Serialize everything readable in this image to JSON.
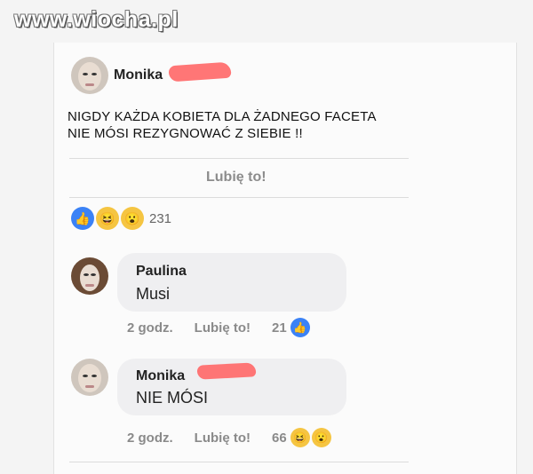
{
  "watermark": "www.wiocha.pl",
  "post": {
    "author": "Monika",
    "line1": "NIGDY KAŻDA KOBIETA DLA ŻADNEGO FACETA",
    "line2": "NIE MÓSI  REZYGNOWAĆ Z SIEBIE !!",
    "like_label": "Lubię to!",
    "reaction_count": "231",
    "reactions": [
      "like-icon",
      "haha-icon",
      "wow-icon"
    ]
  },
  "comments": [
    {
      "author": "Paulina",
      "text": "Musi",
      "time": "2 godz.",
      "like": "Lubię to!",
      "count": "21",
      "reactions": [
        "like-icon"
      ]
    },
    {
      "author": "Monika",
      "text": "NIE MÓSI",
      "time": "2 godz.",
      "like": "Lubię to!",
      "count": "66",
      "reactions": [
        "haha-icon",
        "wow-icon"
      ]
    }
  ],
  "colors": {
    "like": "#3b82f6",
    "emoji": "#f5c542",
    "scribble": "#ff6a6a",
    "bubble": "#efeff1"
  }
}
